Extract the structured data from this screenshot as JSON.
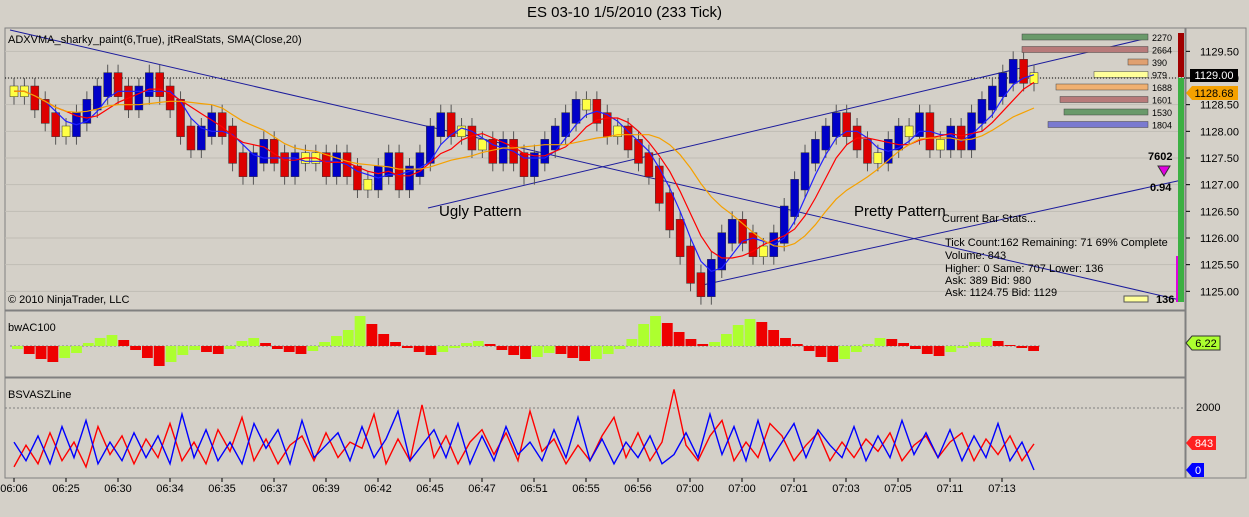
{
  "window_title": "ES 03-10  1/5/2010 (233 Tick)",
  "price_panel": {
    "indicator_label": "ADXVMA_sharky_paint(6,True), jtRealStats, SMA(Close,20)",
    "copyright": "© 2010 NinjaTrader, LLC",
    "annotations": {
      "ugly": "Ugly Pattern",
      "pretty": "Pretty Pattern"
    },
    "stats": {
      "title": "Current Bar Stats...",
      "lines": [
        "Tick Count:162  Remaining: 71  69% Complete",
        "Volume: 843",
        "Higher: 0   Same: 707   Lower: 136",
        "Ask:   389       Bid:   980",
        "Ask: 1124.75  Bid: 1129"
      ]
    },
    "stat_big": "7602",
    "stat_ratio": "0.94",
    "bottom_count": "136",
    "ladder": [
      {
        "label": "2270",
        "color": "#6a9a6a"
      },
      {
        "label": "2664",
        "color": "#b87a7a"
      },
      {
        "label": "390",
        "color": "#e0a070"
      },
      {
        "label": "979",
        "color": "#ffff99"
      },
      {
        "label": "1688",
        "color": "#f0b070"
      },
      {
        "label": "1601",
        "color": "#b87a7a"
      },
      {
        "label": "1530",
        "color": "#6a9a6a"
      },
      {
        "label": "1804",
        "color": "#7a7ad0"
      }
    ],
    "last_price": "1129.00",
    "sma_price": "1128.68"
  },
  "ac_panel": {
    "label": "bwAC100",
    "value": "6.22"
  },
  "bsv_panel": {
    "label": "BSVASZLine",
    "red_value": "843",
    "blue_value": "0",
    "tick_2000": "2000"
  },
  "chart_data": [
    {
      "type": "candlestick",
      "title": "ES 03-10  1/5/2010 (233 Tick)",
      "y_ticks": [
        "1129.50",
        "1129.00",
        "1128.50",
        "1128.00",
        "1127.50",
        "1127.00",
        "1126.50",
        "1126.00",
        "1125.50",
        "1125.00"
      ],
      "ylim": [
        1124.8,
        1129.9
      ],
      "x_ticks": [
        "06:06",
        "06:25",
        "06:30",
        "06:34",
        "06:35",
        "06:37",
        "06:39",
        "06:42",
        "06:45",
        "06:47",
        "06:51",
        "06:55",
        "06:56",
        "07:00",
        "07:00",
        "07:01",
        "07:03",
        "07:05",
        "07:11",
        "07:13"
      ],
      "close": [
        1128.75,
        1128.75,
        1128.5,
        1128.25,
        1128.0,
        1128.0,
        1128.25,
        1128.5,
        1128.75,
        1129.0,
        1128.75,
        1128.5,
        1128.75,
        1129.0,
        1128.75,
        1128.5,
        1128.0,
        1127.75,
        1128.0,
        1128.25,
        1128.0,
        1127.5,
        1127.25,
        1127.5,
        1127.75,
        1127.5,
        1127.25,
        1127.5,
        1127.5,
        1127.5,
        1127.25,
        1127.5,
        1127.25,
        1127.0,
        1127.0,
        1127.25,
        1127.5,
        1127.0,
        1127.25,
        1127.5,
        1128.0,
        1128.25,
        1128.0,
        1128.0,
        1127.75,
        1127.75,
        1127.5,
        1127.75,
        1127.5,
        1127.25,
        1127.5,
        1127.75,
        1128.0,
        1128.25,
        1128.5,
        1128.5,
        1128.25,
        1128.0,
        1128.0,
        1127.75,
        1127.5,
        1127.25,
        1126.75,
        1126.25,
        1125.75,
        1125.25,
        1125.0,
        1125.5,
        1126.0,
        1126.25,
        1126.0,
        1125.75,
        1125.75,
        1126.0,
        1126.5,
        1127.0,
        1127.5,
        1127.75,
        1128.0,
        1128.25,
        1128.0,
        1127.75,
        1127.5,
        1127.5,
        1127.75,
        1128.0,
        1128.0,
        1128.25,
        1127.75,
        1127.75,
        1128.0,
        1127.75,
        1128.25,
        1128.5,
        1128.75,
        1129.0,
        1129.25,
        1129.0,
        1129.0
      ]
    },
    {
      "type": "bar",
      "title": "bwAC100",
      "values": [
        -0.3,
        -0.8,
        -1.3,
        -1.6,
        -1.2,
        -0.7,
        0.3,
        0.8,
        1.1,
        0.6,
        -0.4,
        -1.2,
        -2.0,
        -1.6,
        -0.9,
        -0.4,
        -0.6,
        -0.8,
        -0.3,
        0.5,
        0.8,
        0.3,
        -0.3,
        -0.6,
        -0.8,
        -0.5,
        0.4,
        1.0,
        1.6,
        3.0,
        2.2,
        1.2,
        0.4,
        -0.2,
        -0.6,
        -0.9,
        -0.6,
        -0.2,
        0.3,
        0.5,
        0.2,
        -0.4,
        -0.9,
        -1.3,
        -1.1,
        -0.7,
        -0.8,
        -1.2,
        -1.5,
        -1.3,
        -0.8,
        -0.3,
        0.7,
        2.2,
        3.0,
        2.3,
        1.4,
        0.7,
        0.2,
        0.4,
        1.2,
        2.1,
        2.7,
        2.4,
        1.6,
        0.8,
        0.2,
        -0.5,
        -1.1,
        -1.6,
        -1.3,
        -0.6,
        0.2,
        0.8,
        0.7,
        0.3,
        -0.3,
        -0.8,
        -1.0,
        -0.6,
        -0.2,
        0.4,
        0.8,
        0.5,
        0.1,
        -0.2,
        -0.5
      ]
    },
    {
      "type": "line",
      "title": "BSVASZLine",
      "y_ticks": [
        "2000",
        "0"
      ],
      "series": [
        {
          "name": "",
          "color": "#ff0000",
          "values": [
            100,
            800,
            200,
            1200,
            300,
            900,
            100,
            1400,
            500,
            1100,
            200,
            1000,
            400,
            1500,
            300,
            900,
            200,
            1300,
            600,
            1700,
            300,
            1000,
            200,
            800,
            1100,
            300,
            1200,
            400,
            900,
            700,
            1800,
            200,
            1000,
            300,
            2100,
            400,
            1100,
            200,
            900,
            1300,
            500,
            1200,
            300,
            1900,
            600,
            1000,
            200,
            800,
            300,
            1100,
            1700,
            400,
            1200,
            300,
            900,
            2600,
            800,
            300,
            1100,
            1600,
            300,
            900,
            400,
            1500,
            1100,
            300,
            800,
            1200,
            300,
            900,
            400,
            1000,
            600,
            1200,
            300,
            800,
            1100,
            400,
            900,
            1200,
            300,
            1000,
            500,
            1100,
            300,
            843
          ]
        },
        {
          "name": "",
          "color": "#0000ff",
          "values": [
            900,
            300,
            1100,
            200,
            1400,
            400,
            1600,
            200,
            900,
            300,
            1200,
            400,
            1100,
            200,
            1800,
            400,
            1300,
            300,
            900,
            200,
            1500,
            700,
            1300,
            200,
            1600,
            400,
            800,
            1200,
            300,
            1400,
            400,
            1000,
            1900,
            300,
            800,
            1300,
            400,
            1500,
            200,
            1100,
            300,
            1400,
            500,
            900,
            300,
            1300,
            400,
            1700,
            300,
            1000,
            200,
            900,
            400,
            1100,
            200,
            500,
            1200,
            400,
            1800,
            500,
            1400,
            300,
            1600,
            300,
            900,
            1500,
            400,
            1300,
            800,
            400,
            1400,
            300,
            1100,
            400,
            1600,
            500,
            1200,
            400,
            1300,
            300,
            1100,
            400,
            1500,
            300,
            900,
            0
          ]
        }
      ]
    }
  ]
}
